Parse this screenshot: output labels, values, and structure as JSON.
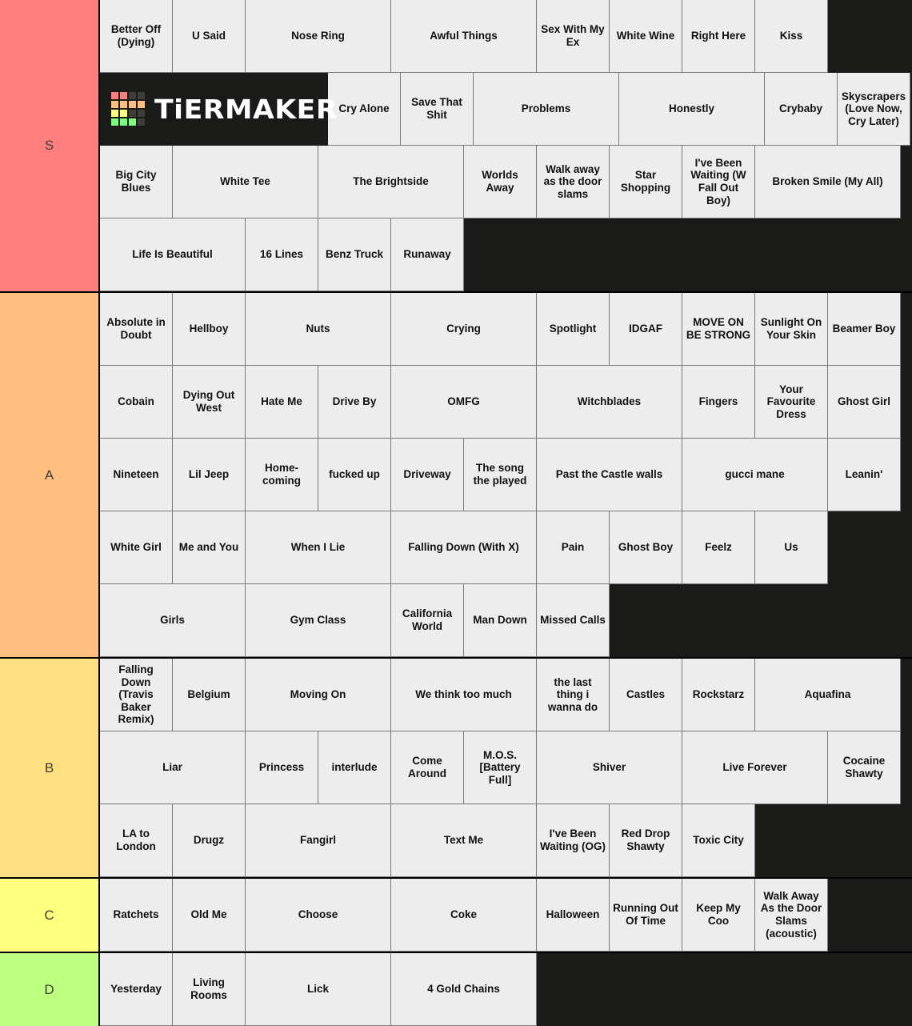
{
  "app": {
    "logo_text": "TiERMAKER",
    "logo_grid_colors": [
      "#FF7F7F",
      "#FF7F7F",
      "#3d3d3b",
      "#3d3d3b",
      "#FFBF7F",
      "#FFBF7F",
      "#FFBF7F",
      "#FFBF7F",
      "#FFFF7F",
      "#FFFF7F",
      "#3d3d3b",
      "#3d3d3b",
      "#7FFF7F",
      "#7FFF7F",
      "#7FFF7F",
      "#3d3d3b"
    ]
  },
  "tiers": [
    {
      "label": "S",
      "color": "#FF7F7F",
      "items": [
        {
          "text": "Better Off (Dying)",
          "span": 1
        },
        {
          "text": "U Said",
          "span": 1
        },
        {
          "text": "Nose Ring",
          "span": 1
        },
        {
          "text": "Awful Things",
          "span": 1
        },
        {
          "text": "Sex With My Ex",
          "span": 1
        },
        {
          "text": "White Wine",
          "span": 1
        },
        {
          "text": "Right Here",
          "span": 1
        },
        {
          "text": "Kiss",
          "span": 1
        },
        {
          "text": "Cry Alone",
          "span": 1
        },
        {
          "text": "Save That Shit",
          "span": 1
        },
        {
          "text": "Problems",
          "span": 1
        },
        {
          "text": "Honestly",
          "span": 1
        },
        {
          "text": "Crybaby",
          "span": 1
        },
        {
          "text": "Skyscrapers (Love Now, Cry Later)",
          "span": 1
        },
        {
          "text": "Big City Blues",
          "span": 1
        },
        {
          "text": "White Tee",
          "span": 1
        },
        {
          "text": "The Brightside",
          "span": 1
        },
        {
          "text": "Worlds Away",
          "span": 1
        },
        {
          "text": "Walk away as the door slams",
          "span": 1
        },
        {
          "text": "Star Shopping",
          "span": 1
        },
        {
          "text": "I've Been Waiting (W Fall Out Boy)",
          "span": 1
        },
        {
          "text": "Broken Smile (My All)",
          "span": 1
        },
        {
          "text": "Life Is Beautiful",
          "span": 1
        },
        {
          "text": "16 Lines",
          "span": 1
        },
        {
          "text": "Benz Truck",
          "span": 1
        },
        {
          "text": "Runaway",
          "span": 1
        }
      ]
    },
    {
      "label": "A",
      "color": "#FFBF7F",
      "items": [
        {
          "text": "Absolute in Doubt",
          "span": 1
        },
        {
          "text": "Hellboy",
          "span": 1
        },
        {
          "text": "Nuts",
          "span": 1
        },
        {
          "text": "Crying",
          "span": 1
        },
        {
          "text": "Spotlight",
          "span": 1
        },
        {
          "text": "IDGAF",
          "span": 1
        },
        {
          "text": "MOVE ON BE STRONG",
          "span": 1
        },
        {
          "text": "Sunlight On Your Skin",
          "span": 1
        },
        {
          "text": "Beamer Boy",
          "span": 1
        },
        {
          "text": "Cobain",
          "span": 1
        },
        {
          "text": "Dying Out West",
          "span": 1
        },
        {
          "text": "Hate Me",
          "span": 1
        },
        {
          "text": "Drive By",
          "span": 1
        },
        {
          "text": "OMFG",
          "span": 1
        },
        {
          "text": "Witchblades",
          "span": 1
        },
        {
          "text": "Fingers",
          "span": 1
        },
        {
          "text": "Your Favourite Dress",
          "span": 1
        },
        {
          "text": "Ghost Girl",
          "span": 1
        },
        {
          "text": "Nineteen",
          "span": 1
        },
        {
          "text": "Lil Jeep",
          "span": 1
        },
        {
          "text": "Home-coming",
          "span": 1
        },
        {
          "text": "fucked up",
          "span": 1
        },
        {
          "text": "Driveway",
          "span": 1
        },
        {
          "text": "The song the played",
          "span": 1
        },
        {
          "text": "Past the Castle walls",
          "span": 1
        },
        {
          "text": "gucci mane",
          "span": 1
        },
        {
          "text": "Leanin'",
          "span": 1
        },
        {
          "text": "White Girl",
          "span": 1
        },
        {
          "text": "Me and You",
          "span": 1
        },
        {
          "text": "When I Lie",
          "span": 1
        },
        {
          "text": "Falling Down (With X)",
          "span": 1
        },
        {
          "text": "Pain",
          "span": 1
        },
        {
          "text": "Ghost Boy",
          "span": 1
        },
        {
          "text": "Feelz",
          "span": 1
        },
        {
          "text": "Us",
          "span": 1
        },
        {
          "text": "Girls",
          "span": 1
        },
        {
          "text": "Gym Class",
          "span": 1
        },
        {
          "text": "California World",
          "span": 1
        },
        {
          "text": "Man Down",
          "span": 1
        },
        {
          "text": "Missed Calls",
          "span": 1
        }
      ]
    },
    {
      "label": "B",
      "color": "#FFDF7F",
      "items": [
        {
          "text": "Falling Down (Travis Baker Remix)",
          "span": 1
        },
        {
          "text": "Belgium",
          "span": 1
        },
        {
          "text": "Moving On",
          "span": 1
        },
        {
          "text": "We think too much",
          "span": 1
        },
        {
          "text": "the last thing i wanna do",
          "span": 1
        },
        {
          "text": "Castles",
          "span": 1
        },
        {
          "text": "Rockstarz",
          "span": 1
        },
        {
          "text": "Aquafina",
          "span": 1
        },
        {
          "text": "Liar",
          "span": 1
        },
        {
          "text": "Princess",
          "span": 1
        },
        {
          "text": "interlude",
          "span": 1
        },
        {
          "text": "Come Around",
          "span": 1
        },
        {
          "text": "M.O.S. [Battery Full]",
          "span": 1
        },
        {
          "text": "Shiver",
          "span": 1
        },
        {
          "text": "Live Forever",
          "span": 1
        },
        {
          "text": "Cocaine Shawty",
          "span": 1
        },
        {
          "text": "LA to London",
          "span": 1
        },
        {
          "text": "Drugz",
          "span": 1
        },
        {
          "text": "Fangirl",
          "span": 1
        },
        {
          "text": "Text Me",
          "span": 1
        },
        {
          "text": "I've Been Waiting (OG)",
          "span": 1
        },
        {
          "text": "Red Drop Shawty",
          "span": 1
        },
        {
          "text": "Toxic City",
          "span": 1
        }
      ]
    },
    {
      "label": "C",
      "color": "#FFFF7F",
      "items": [
        {
          "text": "Ratchets",
          "span": 1
        },
        {
          "text": "Old Me",
          "span": 1
        },
        {
          "text": "Choose",
          "span": 1
        },
        {
          "text": "Coke",
          "span": 1
        },
        {
          "text": "Halloween",
          "span": 1
        },
        {
          "text": "Running Out Of Time",
          "span": 1
        },
        {
          "text": "Keep My Coo",
          "span": 1
        },
        {
          "text": "Walk Away As the Door Slams (acoustic)",
          "span": 1
        }
      ]
    },
    {
      "label": "D",
      "color": "#BFFF7F",
      "items": [
        {
          "text": "Yesterday",
          "span": 1
        },
        {
          "text": "Living Rooms",
          "span": 1
        },
        {
          "text": "Lick",
          "span": 1
        },
        {
          "text": "4 Gold Chains",
          "span": 1
        }
      ]
    }
  ]
}
